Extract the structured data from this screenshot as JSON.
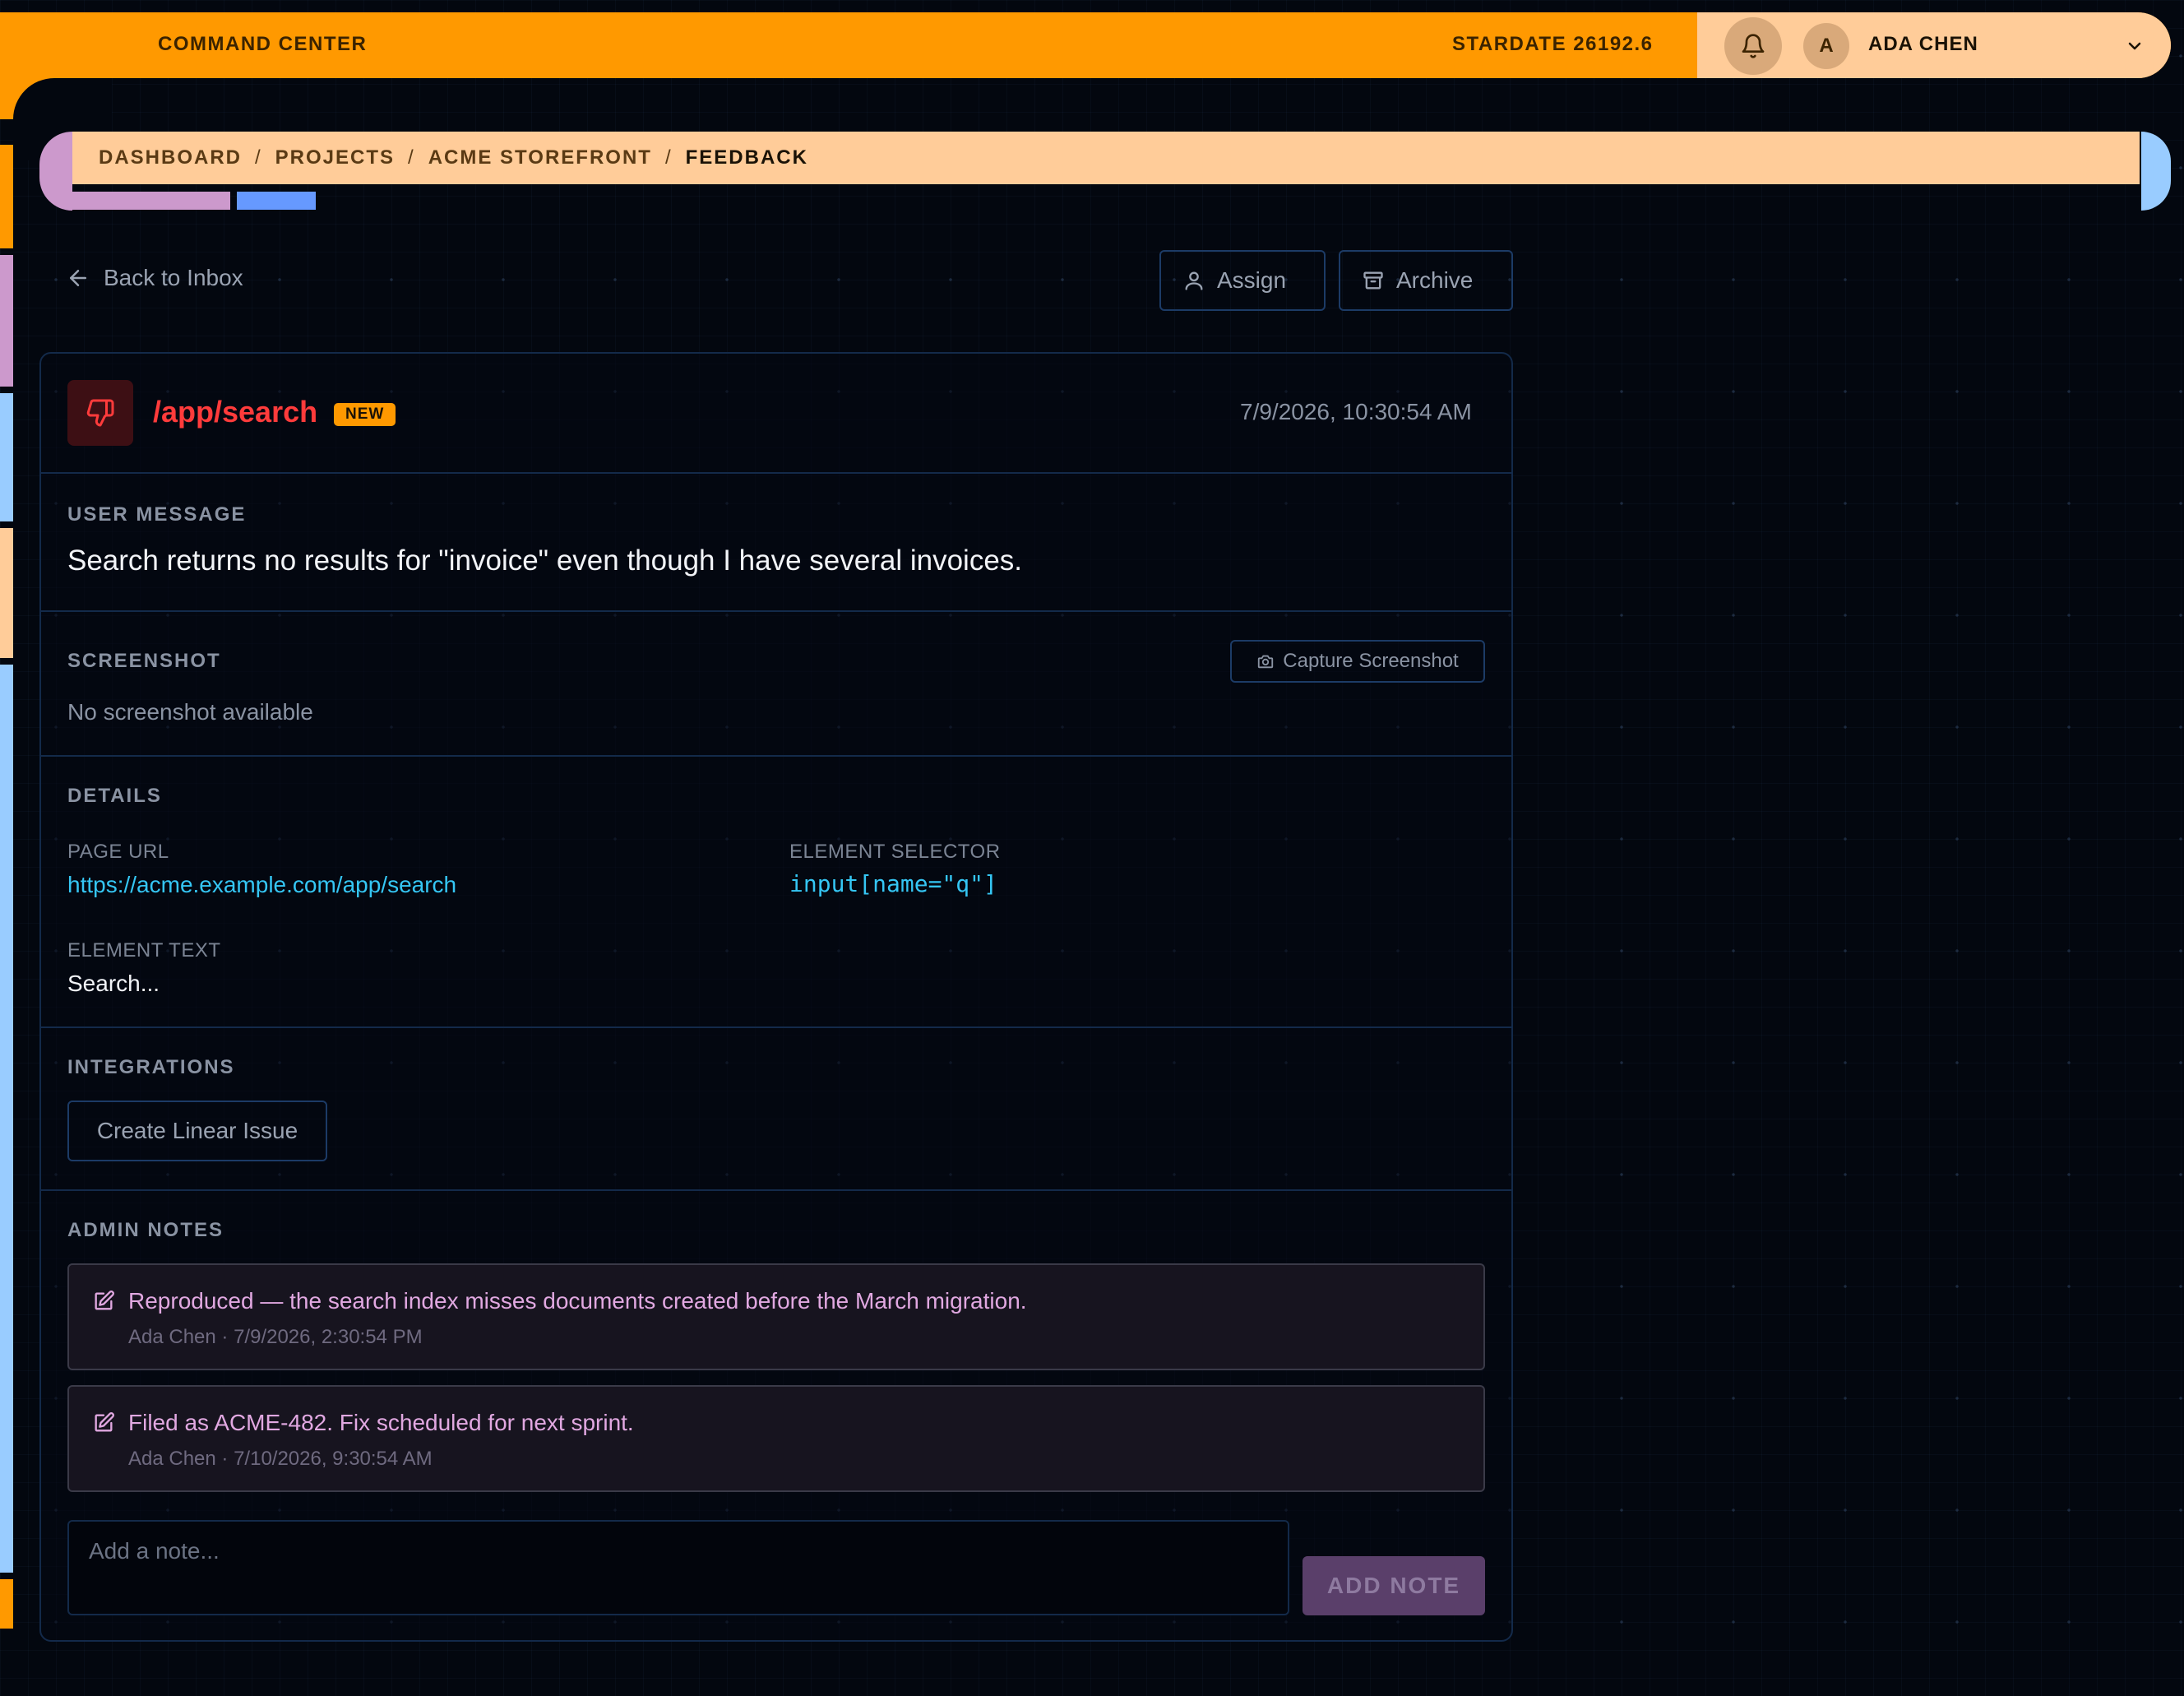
{
  "header": {
    "app_title": "COMMAND CENTER",
    "stardate": "STARDATE 26192.6",
    "user": {
      "initial": "A",
      "name": "ADA CHEN"
    }
  },
  "breadcrumb": [
    "DASHBOARD",
    "PROJECTS",
    "ACME STOREFRONT",
    "FEEDBACK"
  ],
  "actions": {
    "back_label": "Back to Inbox",
    "assign_label": "Assign",
    "archive_label": "Archive"
  },
  "feedback": {
    "path": "/app/search",
    "badge": "NEW",
    "timestamp": "7/9/2026, 10:30:54 AM",
    "user_message_label": "USER MESSAGE",
    "user_message": "Search returns no results for \"invoice\" even though I have several invoices.",
    "screenshot_label": "SCREENSHOT",
    "screenshot_empty": "No screenshot available",
    "capture_label": "Capture Screenshot",
    "details_label": "DETAILS",
    "page_url_label": "PAGE URL",
    "page_url": "https://acme.example.com/app/search",
    "selector_label": "ELEMENT SELECTOR",
    "selector": "input[name=\"q\"]",
    "element_text_label": "ELEMENT TEXT",
    "element_text": "Search...",
    "integrations_label": "INTEGRATIONS",
    "linear_label": "Create Linear Issue"
  },
  "notes": {
    "label": "ADMIN NOTES",
    "items": [
      {
        "text": "Reproduced — the search index misses documents created before the March migration.",
        "meta": "Ada Chen · 7/9/2026, 2:30:54 PM"
      },
      {
        "text": "Filed as ACME-482. Fix scheduled for next sprint.",
        "meta": "Ada Chen · 7/10/2026, 9:30:54 AM"
      }
    ],
    "placeholder": "Add a note...",
    "add_label": "ADD NOTE"
  },
  "colors": {
    "orange": "#ff9900",
    "peach": "#ffcc99",
    "lilac": "#cc99cc",
    "sky": "#99ccff",
    "blue": "#6699ff",
    "danger": "#ff3b3b",
    "link": "#35c6f4"
  },
  "icons": [
    "bell-icon",
    "chevron-down-icon",
    "arrow-left-icon",
    "user-icon",
    "archive-icon",
    "thumbs-down-icon",
    "camera-icon",
    "edit-note-icon"
  ]
}
